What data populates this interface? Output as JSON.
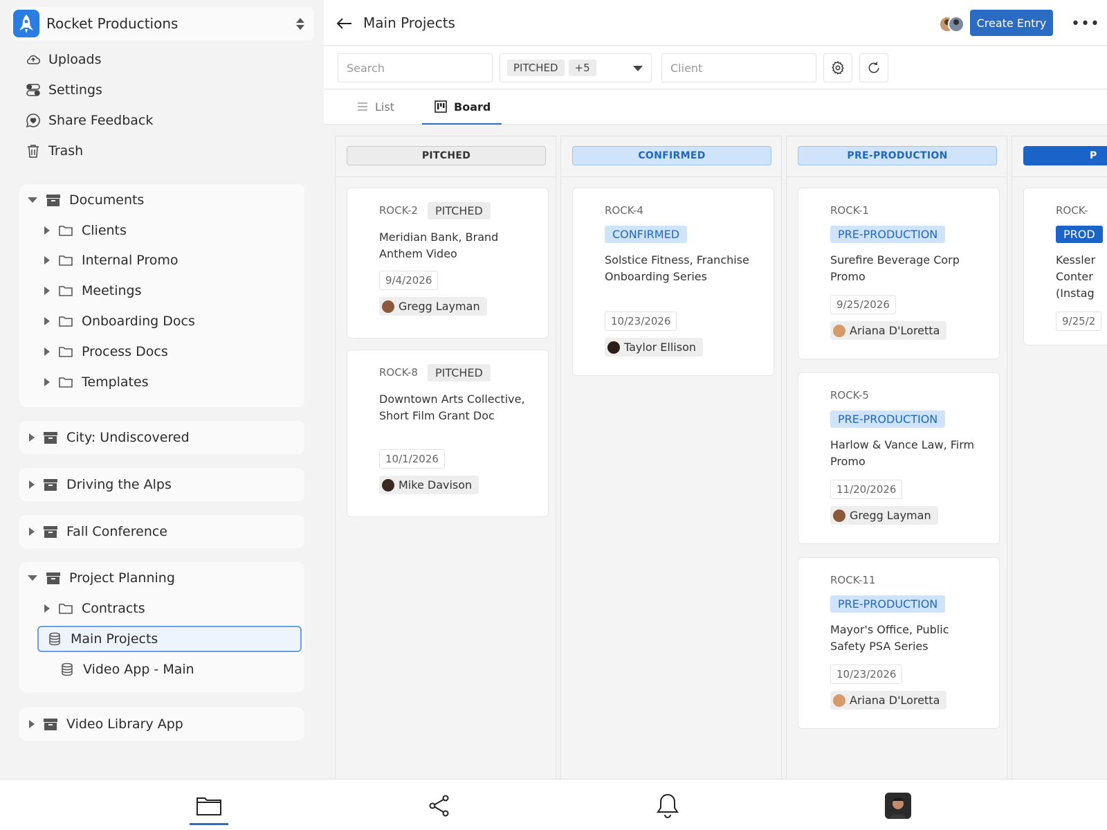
{
  "workspace": {
    "name": "Rocket Productions"
  },
  "menu": [
    {
      "label": "Uploads",
      "icon": "cloud-upload-icon"
    },
    {
      "label": "Settings",
      "icon": "toggles-icon"
    },
    {
      "label": "Share Feedback",
      "icon": "chat-heart-icon"
    },
    {
      "label": "Trash",
      "icon": "trash-icon"
    }
  ],
  "tree": {
    "documents": {
      "label": "Documents",
      "children": [
        "Clients",
        "Internal Promo",
        "Meetings",
        "Onboarding Docs",
        "Process Docs",
        "Templates"
      ]
    },
    "city": {
      "label": "City: Undiscovered"
    },
    "alps": {
      "label": "Driving the Alps"
    },
    "fall": {
      "label": "Fall Conference"
    },
    "planning": {
      "label": "Project Planning",
      "contracts": "Contracts",
      "main_projects": "Main Projects",
      "video_app": "Video App - Main"
    },
    "library": {
      "label": "Video Library App"
    }
  },
  "header": {
    "title": "Main Projects",
    "create_label": "Create Entry",
    "more_label": "•••"
  },
  "filters": {
    "search_placeholder": "Search",
    "status_chip": "PITCHED",
    "status_more": "+5",
    "client_placeholder": "Client"
  },
  "tabs": {
    "list": "List",
    "board": "Board"
  },
  "board": {
    "columns": [
      {
        "title": "PITCHED",
        "cards": [
          {
            "id": "ROCK-2",
            "status": "PITCHED",
            "title": "Meridian Bank, Brand Anthem Video",
            "date": "9/4/2026",
            "person": "Gregg Layman"
          },
          {
            "id": "ROCK-8",
            "status": "PITCHED",
            "title": "Downtown Arts Collective, Short Film Grant Doc",
            "date": "10/1/2026",
            "person": "Mike Davison"
          }
        ]
      },
      {
        "title": "CONFIRMED",
        "cards": [
          {
            "id": "ROCK-4",
            "status": "CONFIRMED",
            "title": "Solstice Fitness, Franchise Onboarding Series",
            "date": "10/23/2026",
            "person": "Taylor Ellison"
          }
        ]
      },
      {
        "title": "PRE-PRODUCTION",
        "cards": [
          {
            "id": "ROCK-1",
            "status": "PRE-PRODUCTION",
            "title": "Surefire Beverage Corp Promo",
            "date": "9/25/2026",
            "person": "Ariana D'Loretta"
          },
          {
            "id": "ROCK-5",
            "status": "PRE-PRODUCTION",
            "title": "Harlow & Vance Law, Firm Promo",
            "date": "11/20/2026",
            "person": "Gregg Layman"
          },
          {
            "id": "ROCK-11",
            "status": "PRE-PRODUCTION",
            "title": "Mayor's Office, Public Safety PSA Series",
            "date": "10/23/2026",
            "person": "Ariana D'Loretta"
          }
        ]
      },
      {
        "title": "P",
        "cards": [
          {
            "id": "ROCK-",
            "status": "PROD",
            "title_lines": [
              "Kessler",
              "Conter",
              "(Instag"
            ],
            "date": "9/25/2"
          }
        ]
      }
    ]
  },
  "colors": {
    "accent": "#2a6cc4",
    "pitched_bg": "#ececec",
    "confirmed_bg": "#cfe4fb",
    "confirmed_fg": "#1f67c2",
    "production_bg": "#1a63c9"
  },
  "bottom_nav": [
    "folder-icon",
    "share-icon",
    "bell-icon",
    "profile-avatar"
  ]
}
